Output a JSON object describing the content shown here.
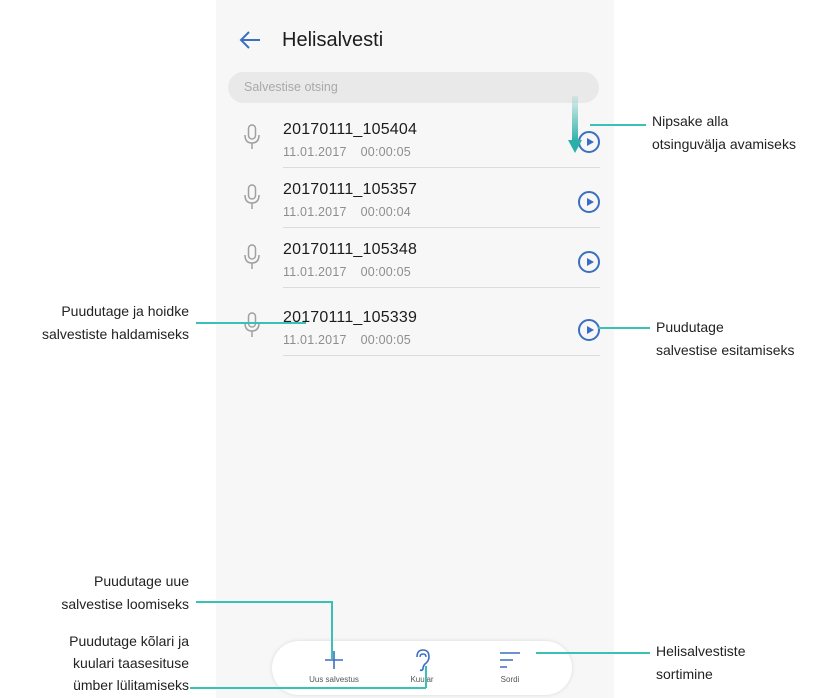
{
  "app": {
    "title": "Helisalvesti"
  },
  "search": {
    "placeholder": "Salvestise otsing"
  },
  "recordings": [
    {
      "name": "20170111_105404",
      "date": "11.01.2017",
      "duration": "00:00:05"
    },
    {
      "name": "20170111_105357",
      "date": "11.01.2017",
      "duration": "00:00:04"
    },
    {
      "name": "20170111_105348",
      "date": "11.01.2017",
      "duration": "00:00:05"
    },
    {
      "name": "20170111_105339",
      "date": "11.01.2017",
      "duration": "00:00:05"
    }
  ],
  "bottom_bar": {
    "new_label": "Uus salvestus",
    "speaker_label": "Kuular",
    "sort_label": "Sordi"
  },
  "callouts": {
    "swipe": [
      "Nipsake alla",
      "otsinguvälja avamiseks"
    ],
    "manage": [
      "Puudutage ja hoidke",
      "salvestiste haldamiseks"
    ],
    "play": [
      "Puudutage",
      "salvestise esitamiseks"
    ],
    "new": [
      "Puudutage uue",
      "salvestise loomiseks"
    ],
    "speaker": [
      "Puudutage kõlari ja",
      "kuulari taasesituse",
      "ümber lülitamiseks"
    ],
    "sort": [
      "Helisalvestiste",
      "sortimine"
    ]
  },
  "colors": {
    "accent": "#3b6fbf",
    "callout_line": "#3cbfb6",
    "swipe_arrow": "#2bb0a8"
  }
}
